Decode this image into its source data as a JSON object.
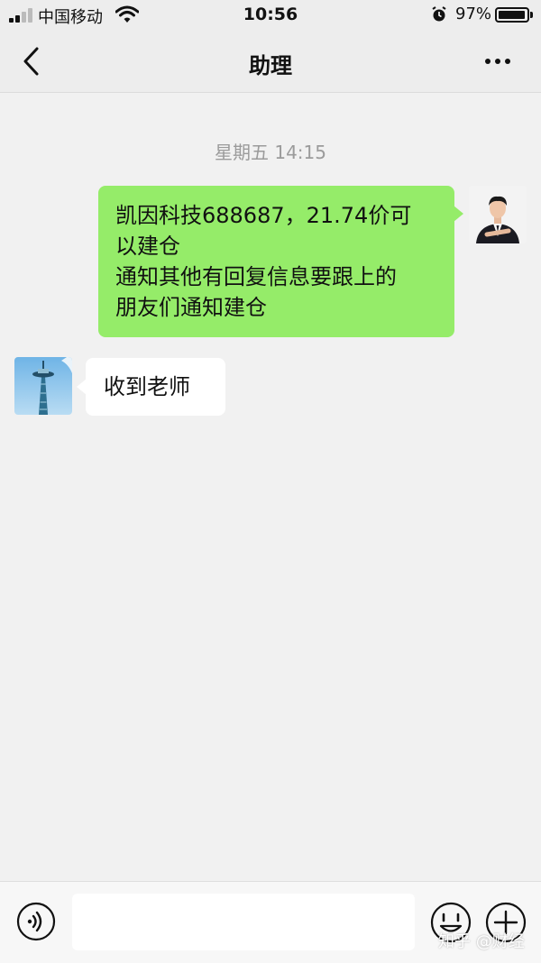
{
  "status_bar": {
    "carrier": "中国移动",
    "time": "10:56",
    "battery_percent": "97%",
    "battery_level": 0.97,
    "icons": [
      "signal-icon",
      "wifi-icon",
      "alarm-icon",
      "battery-icon"
    ]
  },
  "nav": {
    "title": "助理",
    "back_icon": "chevron-left-icon",
    "more_icon": "more-dots-icon"
  },
  "chat": {
    "timestamp": "星期五 14:15",
    "messages": [
      {
        "direction": "sent",
        "lines": [
          "凯因科技688687，21.74价可",
          "以建仓",
          "通知其他有回复信息要跟上的",
          "朋友们通知建仓"
        ],
        "bubble_color": "#95ec69"
      },
      {
        "direction": "received",
        "text": "收到老师",
        "bubble_color": "#ffffff"
      }
    ]
  },
  "input_bar": {
    "placeholder": "",
    "voice_icon": "voice-icon",
    "emoji_icon": "emoji-icon",
    "plus_icon": "plus-icon"
  },
  "watermark": "知乎 @财经",
  "colors": {
    "background": "#f1f1f1",
    "sent_bubble": "#95ec69",
    "received_bubble": "#ffffff",
    "timestamp": "#9b9b9b"
  }
}
